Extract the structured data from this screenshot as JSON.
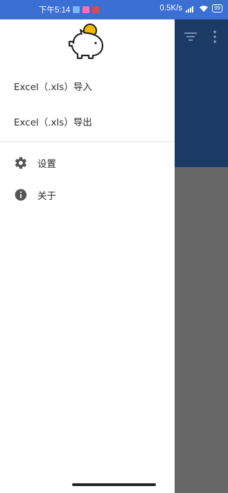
{
  "status_bar": {
    "time": "下午5:14",
    "app_icons": [
      "blue",
      "pink",
      "red"
    ],
    "network_speed": "0.5K/s",
    "battery": "99",
    "colors": {
      "background": "#3b6fd4"
    }
  },
  "drawer": {
    "logo_icon": "piggy-bank-icon",
    "items": [
      {
        "label": "Excel（.xls）导入"
      },
      {
        "label": "Excel（.xls）导出"
      }
    ],
    "secondary_items": [
      {
        "label": "设置",
        "icon": "gear-icon"
      },
      {
        "label": "关于",
        "icon": "info-icon"
      }
    ]
  },
  "background_app": {
    "toolbar_icons": [
      "filter-icon",
      "more-vert-icon"
    ],
    "colors": {
      "header": "#1c3a66",
      "scrim": "#666666"
    }
  }
}
